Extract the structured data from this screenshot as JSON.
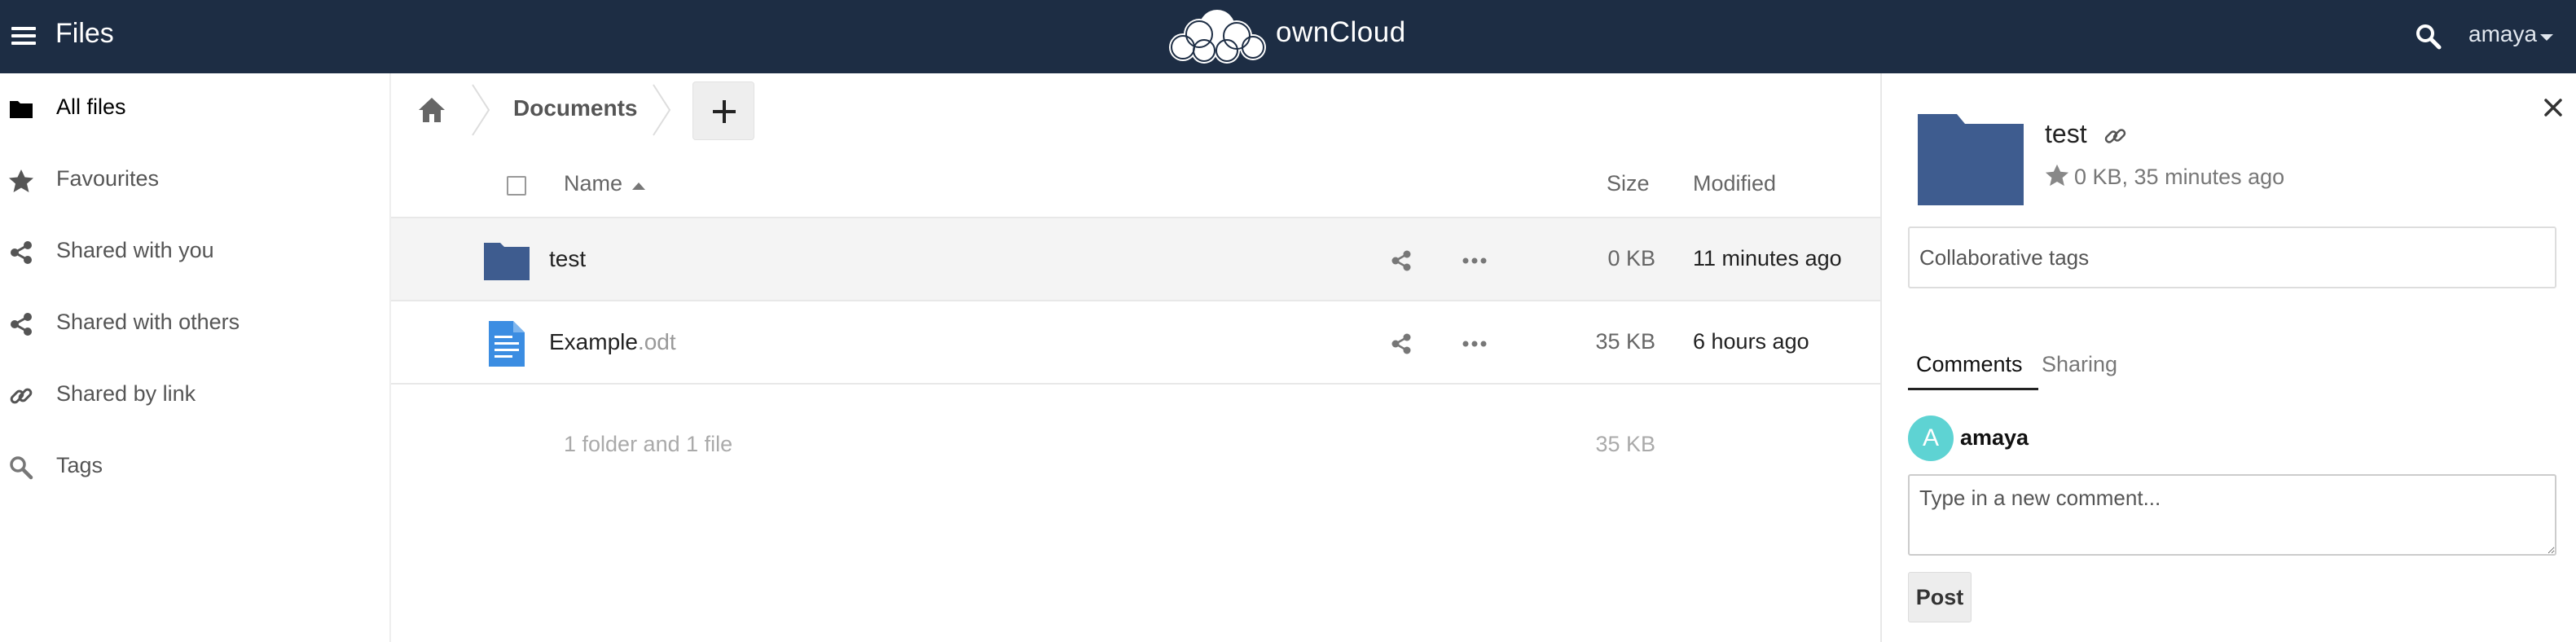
{
  "header": {
    "app_title": "Files",
    "brand": "ownCloud",
    "user": "amaya"
  },
  "sidebar": {
    "items": [
      {
        "label": "All files",
        "icon": "folder-icon",
        "active": true
      },
      {
        "label": "Favourites",
        "icon": "star-icon",
        "active": false
      },
      {
        "label": "Shared with you",
        "icon": "share-icon",
        "active": false
      },
      {
        "label": "Shared with others",
        "icon": "share-icon",
        "active": false
      },
      {
        "label": "Shared by link",
        "icon": "link-icon",
        "active": false
      },
      {
        "label": "Tags",
        "icon": "search-icon",
        "active": false
      }
    ]
  },
  "breadcrumb": {
    "current": "Documents"
  },
  "table": {
    "columns": {
      "name": "Name",
      "size": "Size",
      "modified": "Modified"
    },
    "rows": [
      {
        "name": "test",
        "ext": "",
        "type": "folder",
        "size": "0 KB",
        "modified": "11 minutes ago",
        "selected": true
      },
      {
        "name": "Example",
        "ext": ".odt",
        "type": "document",
        "size": "35 KB",
        "modified": "6 hours ago",
        "selected": false
      }
    ],
    "summary": {
      "text": "1 folder and 1 file",
      "size": "35 KB"
    }
  },
  "details": {
    "title": "test",
    "meta": "0 KB, 35 minutes ago",
    "tags_placeholder": "Collaborative tags",
    "tabs": {
      "comments": "Comments",
      "sharing": "Sharing"
    },
    "comment": {
      "avatar_letter": "A",
      "author": "amaya",
      "placeholder": "Type in a new comment...",
      "post_label": "Post"
    }
  },
  "colors": {
    "header_bg": "#1d2d44",
    "folder": "#3e5c8f",
    "document": "#3b8de2",
    "avatar": "#5ed3d3"
  }
}
